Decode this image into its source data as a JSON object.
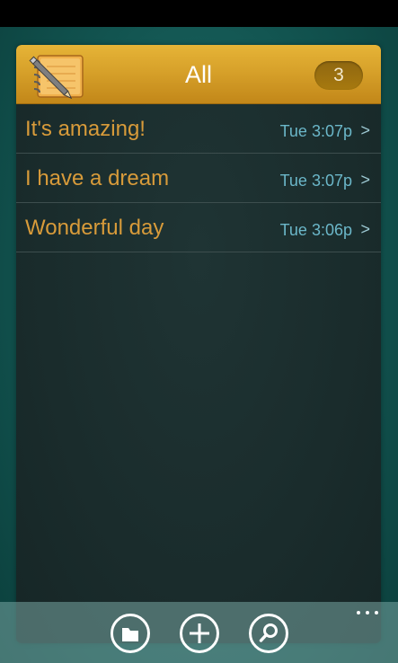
{
  "header": {
    "title": "All",
    "count": "3",
    "icon": "notebook-pencil-icon",
    "accent_color": "#d7a12a"
  },
  "notes": [
    {
      "title": "It's amazing!",
      "time": "Tue 3:07p",
      "chevron": ">"
    },
    {
      "title": "I have a dream",
      "time": "Tue 3:07p",
      "chevron": ">"
    },
    {
      "title": "Wonderful day",
      "time": "Tue 3:06p",
      "chevron": ">"
    }
  ],
  "app_bar": {
    "buttons": [
      {
        "icon": "folder-icon"
      },
      {
        "icon": "add-icon"
      },
      {
        "icon": "search-icon"
      }
    ],
    "more_icon": "more-dots-icon"
  },
  "colors": {
    "note_title": "#d89b3a",
    "note_time": "#6bb7c9",
    "panel_bg": "#1c2f2f",
    "app_bg": "#125450"
  }
}
